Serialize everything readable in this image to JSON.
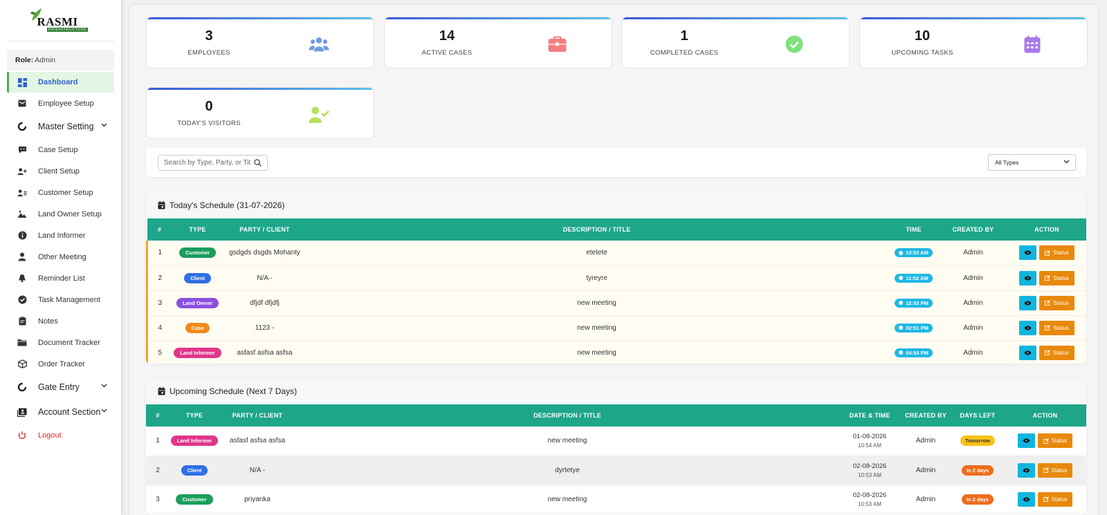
{
  "brand": {
    "name": "RASMI",
    "subtitle": "INFRASTRUCTURE"
  },
  "role": {
    "label": "Role:",
    "value": "Admin"
  },
  "sidebar": {
    "items": [
      {
        "label": "Dashboard",
        "icon": "dashboard-icon"
      },
      {
        "label": "Employee Setup",
        "icon": "envelope-icon"
      },
      {
        "label": "Master Setting",
        "icon": "pie-icon"
      },
      {
        "label": "Case Setup",
        "icon": "comment-icon"
      },
      {
        "label": "Client Setup",
        "icon": "user-plus-icon"
      },
      {
        "label": "Customer Setup",
        "icon": "user-list-icon"
      },
      {
        "label": "Land Owner Setup",
        "icon": "landscape-icon"
      },
      {
        "label": "Land Informer",
        "icon": "info-icon"
      },
      {
        "label": "Other Meeting",
        "icon": "user-icon"
      },
      {
        "label": "Reminder List",
        "icon": "bell-icon"
      },
      {
        "label": "Task Management",
        "icon": "check-circle-icon"
      },
      {
        "label": "Notes",
        "icon": "notes-icon"
      },
      {
        "label": "Document Tracker",
        "icon": "folder-icon"
      },
      {
        "label": "Order Tracker",
        "icon": "box-icon"
      },
      {
        "label": "Gate Entry",
        "icon": "pie-icon"
      },
      {
        "label": "Account Section",
        "icon": "id-card-icon"
      },
      {
        "label": "Logout",
        "icon": "power-icon"
      }
    ]
  },
  "stats": [
    {
      "value": "3",
      "label": "EMPLOYEES",
      "icon": "users-icon",
      "color": "#6f9be0"
    },
    {
      "value": "14",
      "label": "ACTIVE CASES",
      "icon": "briefcase-icon",
      "color": "#f27e7e"
    },
    {
      "value": "1",
      "label": "COMPLETED CASES",
      "icon": "check-circle-icon",
      "color": "#7ee07e"
    },
    {
      "value": "10",
      "label": "UPCOMING TASKS",
      "icon": "calendar-icon",
      "color": "#a77be8"
    },
    {
      "value": "0",
      "label": "TODAY'S VISITORS",
      "icon": "user-check-icon",
      "color": "#b7e05a"
    }
  ],
  "filters": {
    "search_placeholder": "Search by Type, Party, or Title",
    "type_select": "All Types"
  },
  "today": {
    "title": "Today's Schedule (31-07-2026)",
    "columns": [
      "#",
      "TYPE",
      "PARTY / CLIENT",
      "DESCRIPTION / TITLE",
      "TIME",
      "CREATED BY",
      "ACTION"
    ],
    "rows": [
      {
        "n": "1",
        "type": "Customer",
        "party": "gsdgds dsgds Mohanty",
        "desc": "etetete",
        "time": "10:53 AM",
        "by": "Admin"
      },
      {
        "n": "2",
        "type": "Client",
        "party": "N/A -",
        "desc": "tyreyre",
        "time": "11:52 AM",
        "by": "Admin"
      },
      {
        "n": "3",
        "type": "Land Owner",
        "party": "dfjdf dfjdfj",
        "desc": "new meeting",
        "time": "12:53 PM",
        "by": "Admin"
      },
      {
        "n": "4",
        "type": "Case",
        "party": "1123 -",
        "desc": "new meeting",
        "time": "02:51 PM",
        "by": "Admin"
      },
      {
        "n": "5",
        "type": "Land Informer",
        "party": "asfasf asfsa asfsa",
        "desc": "new meeting",
        "time": "04:54 PM",
        "by": "Admin"
      }
    ]
  },
  "upcoming": {
    "title": "Upcoming Schedule (Next 7 Days)",
    "columns": [
      "#",
      "TYPE",
      "PARTY / CLIENT",
      "DESCRIPTION / TITLE",
      "DATE & TIME",
      "CREATED BY",
      "DAYS LEFT",
      "ACTION"
    ],
    "rows": [
      {
        "n": "1",
        "type": "Land Informer",
        "party": "asfasf asfsa asfsa",
        "desc": "new meeting",
        "date": "01-08-2026",
        "time": "10:54 AM",
        "by": "Admin",
        "days": "Tomorrow"
      },
      {
        "n": "2",
        "type": "Client",
        "party": "N/A -",
        "desc": "dyrtetye",
        "date": "02-08-2026",
        "time": "10:53 AM",
        "by": "Admin",
        "days": "In 2 days"
      },
      {
        "n": "3",
        "type": "Customer",
        "party": "priyanka",
        "desc": "new meeting",
        "date": "02-08-2026",
        "time": "10:53 AM",
        "by": "Admin",
        "days": "In 2 days"
      }
    ]
  },
  "actions": {
    "status_label": "Status"
  },
  "colors": {
    "accent_teal": "#1ea68a",
    "active_nav": "#2e63d0",
    "view_btn": "#12b5de",
    "status_btn": "#e8890c"
  }
}
